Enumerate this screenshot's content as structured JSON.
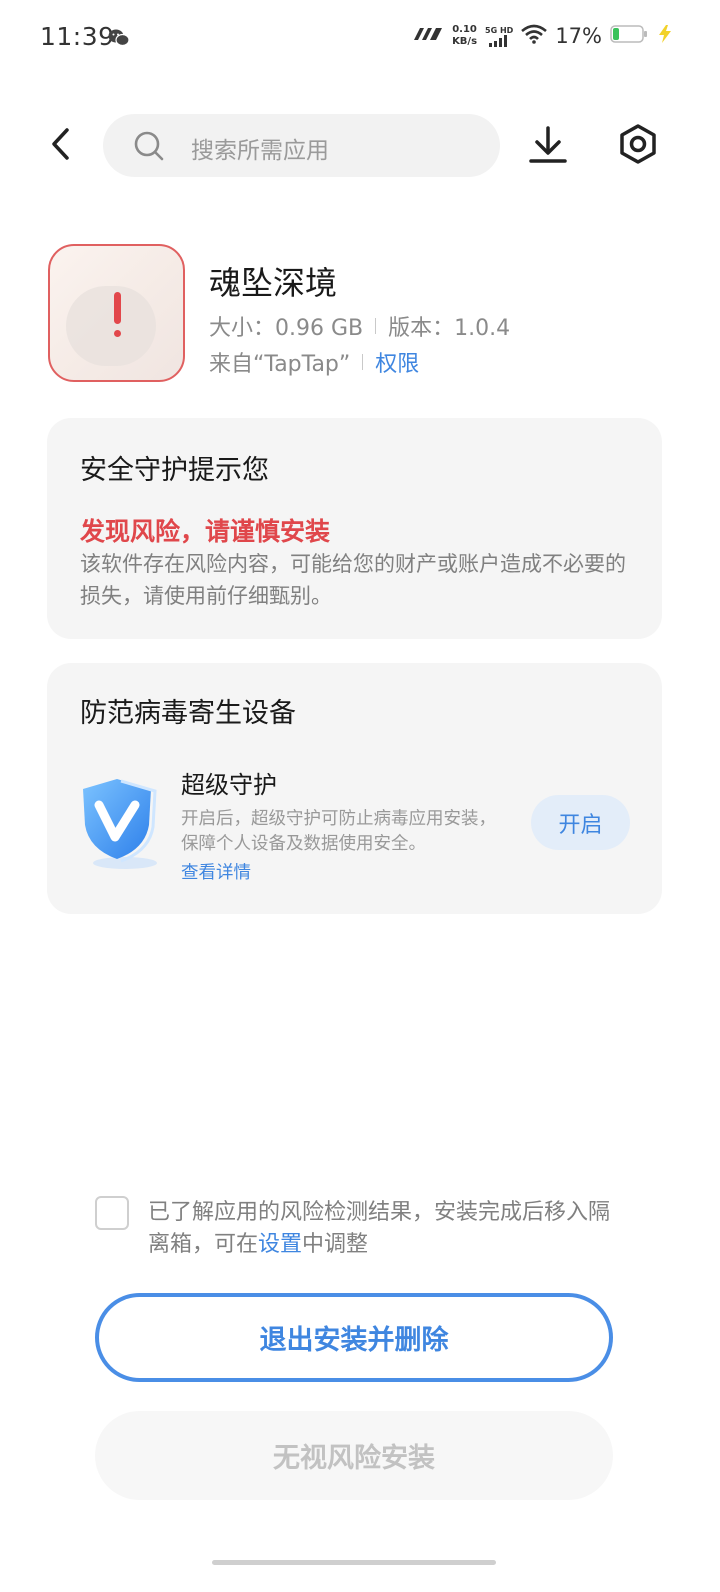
{
  "status_bar": {
    "time": "11:39",
    "net_speed_value": "0.10",
    "net_speed_unit": "KB/s",
    "network": "5G HD",
    "battery_percent": "17%",
    "icons": [
      "wechat-icon",
      "signal-icon",
      "wifi-icon",
      "battery-icon",
      "charging-icon"
    ]
  },
  "header": {
    "search_placeholder": "搜索所需应用",
    "icons": [
      "back-icon",
      "search-icon",
      "download-icon",
      "settings-icon"
    ]
  },
  "app": {
    "name": "魂坠深境",
    "size_label": "大小：0.96 GB",
    "version_label": "版本：1.0.4",
    "source_label": "来自“TapTap”",
    "permissions_link": "权限",
    "risk_color": "#e0474b"
  },
  "security_card": {
    "title": "安全守护提示您",
    "risk_title": "发现风险，请谨慎安装",
    "risk_desc": "该软件存在风险内容，可能给您的财产或账户造成不必要的损失，请使用前仔细甄别。"
  },
  "protect_card": {
    "title": "防范病毒寄生设备",
    "feature_title": "超级守护",
    "feature_desc": "开启后，超级守护可防止病毒应用安装，保障个人设备及数据使用安全。",
    "details_link": "查看详情",
    "enable_button": "开启"
  },
  "agreement": {
    "text_before": "已了解应用的风险检测结果，安装完成后移入隔离箱，可在",
    "link": "设置",
    "text_after": "中调整",
    "checked": false
  },
  "actions": {
    "exit_delete": "退出安装并删除",
    "ignore_install": "无视风险安装"
  },
  "colors": {
    "accent": "#3f86e0",
    "danger": "#e0474b",
    "card_bg": "#f5f5f5"
  }
}
